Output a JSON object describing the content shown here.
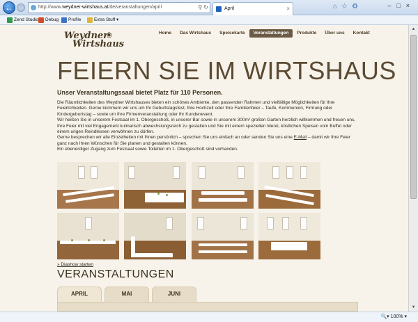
{
  "browser": {
    "url_prefix": "http://www.",
    "url_domain": "weydner-wirtshaus.at",
    "url_path": "/de/veranstaltungen/april",
    "tab_title": "April",
    "favorites": [
      {
        "label": "Zend Studio",
        "color": "#2f9b4a"
      },
      {
        "label": "Debug",
        "color": "#d04b2a"
      },
      {
        "label": "Profile",
        "color": "#3b74c6"
      },
      {
        "label": "Extra Stuff",
        "color": "#e0b53a"
      }
    ],
    "zoom": "100%"
  },
  "site": {
    "logo_line1": "Weydner",
    "logo_line2": "Wirtshaus",
    "nav": [
      {
        "label": "Home"
      },
      {
        "label": "Das Wirtshaus"
      },
      {
        "label": "Speisekarte"
      },
      {
        "label": "Veranstaltungen"
      },
      {
        "label": "Produkte"
      },
      {
        "label": "Über uns"
      },
      {
        "label": "Kontakt"
      }
    ],
    "title": "FEIERN SIE IM WIRTSHAUS",
    "subtitle": "Unser Veranstaltungssaal bietet Platz für 110 Personen.",
    "paragraphs": [
      "Die Räumlichkeiten des Weydner Wirtshauses bieten ein schönes Ambiente, den passenden Rahmen und vielfältige Möglichkeiten für Ihre Feierlichkeiten. Gerne kümmern wir uns um Ihr Geburtstagsfest, Ihre Hochzeit oder Ihre Familienfeier – Taufe, Kommunion, Firmung oder Kindergeburtstag – sowie um Ihre Firmenveranstaltung oder Ihr Kundenevent.",
      "Wir heißen Sie in unserem Festsaal im 1. Obergeschoß, in unserer Bar sowie in unserem 300m² großen Garten herzlich willkommen und freuen uns, Ihre Feier mit viel Engagement kulinarisch abwechslungsreich zu gestalten und Sie mit einem speziellen Menü, köstlichen Speisen vom Buffet oder einem urigen Reindlessen verwöhnen zu dürfen.",
      "Gerne besprechen wir alle Einzelheiten mit Ihnen persönlich – sprechen Sie uns einfach an oder senden Sie uns eine",
      "E-Mail",
      "– damit wir Ihre Feier ganz nach Ihren Wünschen für Sie planen und gestalten können.",
      "Ein ebenerdiger Zugang zum Festsaal sowie Toiletten im 1. Obergeschoß sind vorhanden."
    ],
    "slideshow_link": "» Diashow starten",
    "events_heading": "VERANSTALTUNGEN",
    "months": [
      {
        "label": "APRIL",
        "active": true
      },
      {
        "label": "MAI",
        "active": false
      },
      {
        "label": "JUNI",
        "active": false
      }
    ]
  }
}
